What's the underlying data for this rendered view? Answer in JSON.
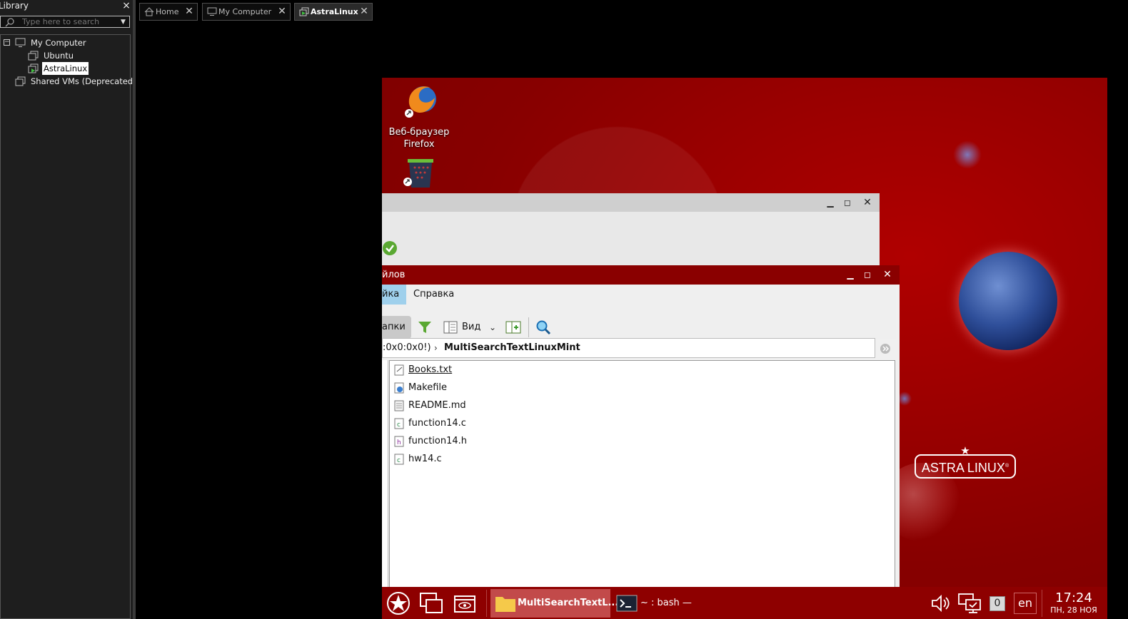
{
  "library": {
    "title": "Library",
    "search_placeholder": "Type here to search",
    "tree": [
      {
        "label": "My Computer"
      },
      {
        "label": "Ubuntu"
      },
      {
        "label": "AstraLinux"
      },
      {
        "label": "Shared VMs (Deprecated)"
      }
    ]
  },
  "tabs": [
    {
      "label": "Home"
    },
    {
      "label": "My Computer"
    },
    {
      "label": "AstraLinux"
    }
  ],
  "desktop": {
    "icons": [
      {
        "label": "Веб-браузер Firefox"
      }
    ],
    "logo_text": "ASTRA LINUX",
    "logo_mark": "®"
  },
  "file_manager": {
    "title_fragment": "йлов",
    "menu": [
      "йка",
      "Справка"
    ],
    "toolbar": {
      "folders_label": "апки",
      "view_label": "Вид"
    },
    "address": {
      "prefix": ":0x0:0x0!)",
      "current": "MultiSearchTextLinuxMint"
    },
    "files": [
      {
        "name": "Books.txt",
        "type": "text"
      },
      {
        "name": "Makefile",
        "type": "make"
      },
      {
        "name": "README.md",
        "type": "doc"
      },
      {
        "name": "function14.c",
        "type": "c"
      },
      {
        "name": "function14.h",
        "type": "h"
      },
      {
        "name": "hw14.c",
        "type": "c"
      }
    ]
  },
  "taskbar": {
    "tasks": [
      {
        "label": "MultiSearchTextL..."
      },
      {
        "label": "~ : bash — Термин..."
      }
    ],
    "notification_count": "0",
    "keyboard_layout": "en",
    "time": "17:24",
    "date": "пн, 28 ноя"
  },
  "colors": {
    "desktop_red": "#870000",
    "taskbar_red": "#8e0000",
    "active_task": "#c24a4a"
  }
}
